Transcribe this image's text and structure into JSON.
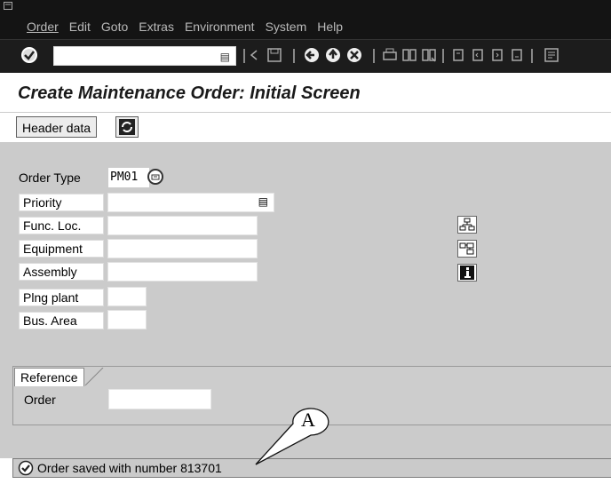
{
  "menu": {
    "items": [
      "Order",
      "Edit",
      "Goto",
      "Extras",
      "Environment",
      "System",
      "Help"
    ]
  },
  "toolbar": {
    "command_field_value": "",
    "icons": [
      "enter-icon",
      "back-icon",
      "save-icon",
      "back-nav-icon",
      "exit-icon",
      "cancel-icon",
      "print-icon",
      "find-icon",
      "find-next-icon",
      "first-page-icon",
      "prev-page-icon",
      "next-page-icon",
      "last-page-icon",
      "new-session-icon"
    ]
  },
  "title": "Create Maintenance Order: Initial Screen",
  "app_toolbar": {
    "header_data_label": "Header data"
  },
  "form": {
    "order_type": {
      "label": "Order Type",
      "value": "PM01"
    },
    "priority": {
      "label": "Priority",
      "value": ""
    },
    "func_loc": {
      "label": "Func. Loc.",
      "value": ""
    },
    "equipment": {
      "label": "Equipment",
      "value": ""
    },
    "assembly": {
      "label": "Assembly",
      "value": ""
    },
    "plng_plant": {
      "label": "Plng plant",
      "value": ""
    },
    "bus_area": {
      "label": "Bus. Area",
      "value": ""
    }
  },
  "side_icons": [
    "structure-icon",
    "hierarchy-icon",
    "info-icon"
  ],
  "reference": {
    "tab_label": "Reference",
    "order_label": "Order",
    "order_value": ""
  },
  "status": {
    "message": "Order saved with number 813701",
    "icon": "success-check-icon"
  },
  "callout": {
    "letter": "A"
  },
  "colors": {
    "menubar_bg": "#141414",
    "form_bg": "#cbcbcb",
    "menu_text": "#b9b9b9"
  }
}
